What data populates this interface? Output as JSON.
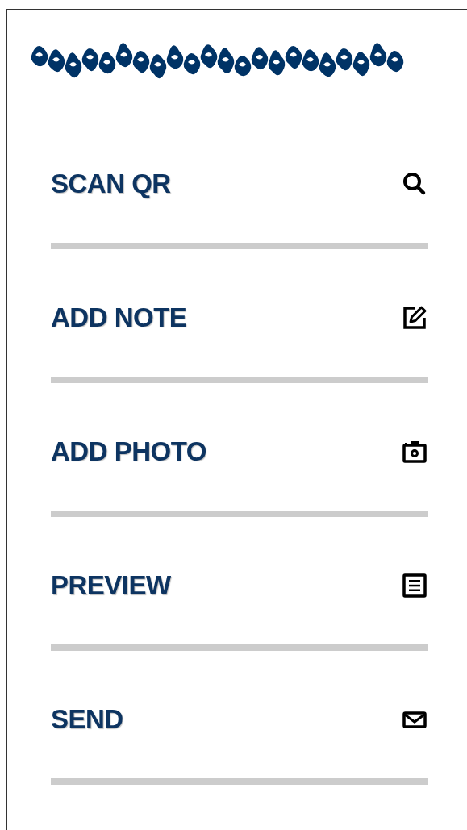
{
  "menu": [
    {
      "label": "SCAN QR",
      "kind": "search"
    },
    {
      "label": "ADD NOTE",
      "kind": "edit"
    },
    {
      "label": "ADD PHOTO",
      "kind": "camera"
    },
    {
      "label": "PREVIEW",
      "kind": "document"
    },
    {
      "label": "SEND",
      "kind": "mail"
    }
  ]
}
